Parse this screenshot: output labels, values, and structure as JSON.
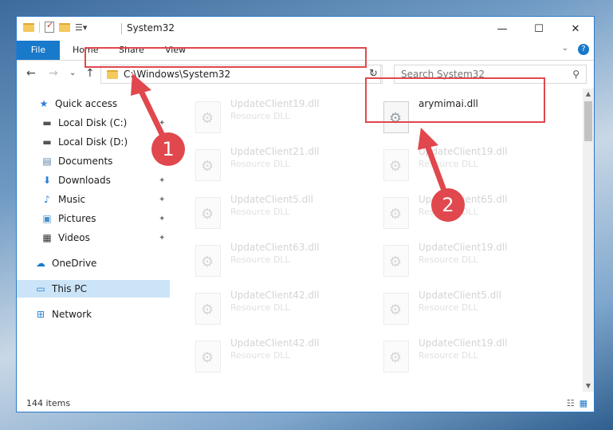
{
  "window": {
    "title": "System32",
    "controls": {
      "minimize": "—",
      "maximize": "☐",
      "close": "✕"
    }
  },
  "ribbon": {
    "tabs": [
      {
        "label": "File"
      },
      {
        "label": "Home"
      },
      {
        "label": "Share"
      },
      {
        "label": "View"
      }
    ],
    "collapse_glyph": "⌄",
    "help_glyph": "?"
  },
  "nav": {
    "back": "←",
    "forward": "→",
    "recent": "⌄",
    "up": "↑"
  },
  "address": {
    "path": "C:\\Windows\\System32",
    "dropdown_glyph": "⌄",
    "refresh_glyph": "↻"
  },
  "search": {
    "placeholder": "Search System32",
    "icon_glyph": "⚲"
  },
  "sidebar": {
    "items": [
      {
        "label": "Quick access",
        "icon": "star-icon",
        "glyph": "★",
        "color": "#2a7fd4"
      },
      {
        "label": "Local Disk (C:)",
        "icon": "drive-icon",
        "glyph": "▬",
        "color": "#555555",
        "pinned": true
      },
      {
        "label": "Local Disk (D:)",
        "icon": "drive-icon",
        "glyph": "▬",
        "color": "#555555",
        "pinned": true
      },
      {
        "label": "Documents",
        "icon": "documents-icon",
        "glyph": "▤",
        "color": "#5b7fa6",
        "pinned": true
      },
      {
        "label": "Downloads",
        "icon": "download-icon",
        "glyph": "⬇",
        "color": "#2a7fd4",
        "pinned": true
      },
      {
        "label": "Music",
        "icon": "music-icon",
        "glyph": "♪",
        "color": "#2a7fd4",
        "pinned": true
      },
      {
        "label": "Pictures",
        "icon": "pictures-icon",
        "glyph": "▣",
        "color": "#4a90c8",
        "pinned": true
      },
      {
        "label": "Videos",
        "icon": "videos-icon",
        "glyph": "▦",
        "color": "#333333",
        "pinned": true
      },
      {
        "label": "OneDrive",
        "icon": "cloud-icon",
        "glyph": "☁",
        "color": "#1979ca"
      },
      {
        "label": "This PC",
        "icon": "computer-icon",
        "glyph": "▭",
        "color": "#2a7fd4",
        "selected": true
      },
      {
        "label": "Network",
        "icon": "network-icon",
        "glyph": "⊞",
        "color": "#2a7fd4"
      }
    ],
    "pin_glyph": "✦"
  },
  "files": [
    {
      "name": "UpdateClient19.dll",
      "type": "Resource DLL",
      "faded": true
    },
    {
      "name": "arymimai.dll",
      "type": "",
      "faded": false
    },
    {
      "name": "UpdateClient21.dll",
      "type": "Resource DLL",
      "faded": true
    },
    {
      "name": "UpdateClient19.dll",
      "type": "Resource DLL",
      "faded": true
    },
    {
      "name": "UpdateClient5.dll",
      "type": "Resource DLL",
      "faded": true
    },
    {
      "name": "UpdateClient65.dll",
      "type": "Resource DLL",
      "faded": true
    },
    {
      "name": "UpdateClient63.dll",
      "type": "Resource DLL",
      "faded": true
    },
    {
      "name": "UpdateClient19.dll",
      "type": "Resource DLL",
      "faded": true
    },
    {
      "name": "UpdateClient42.dll",
      "type": "Resource DLL",
      "faded": true
    },
    {
      "name": "UpdateClient5.dll",
      "type": "Resource DLL",
      "faded": true
    },
    {
      "name": "UpdateClient42.dll",
      "type": "Resource DLL",
      "faded": true
    },
    {
      "name": "UpdateClient19.dll",
      "type": "Resource DLL",
      "faded": true
    }
  ],
  "status": {
    "item_count": "144 items",
    "details_view_glyph": "☷",
    "tiles_view_glyph": "▦"
  },
  "scroll": {
    "up": "▲",
    "down": "▼"
  },
  "annotations": {
    "step1": "1",
    "step2": "2",
    "highlight_color": "#e0484d"
  }
}
